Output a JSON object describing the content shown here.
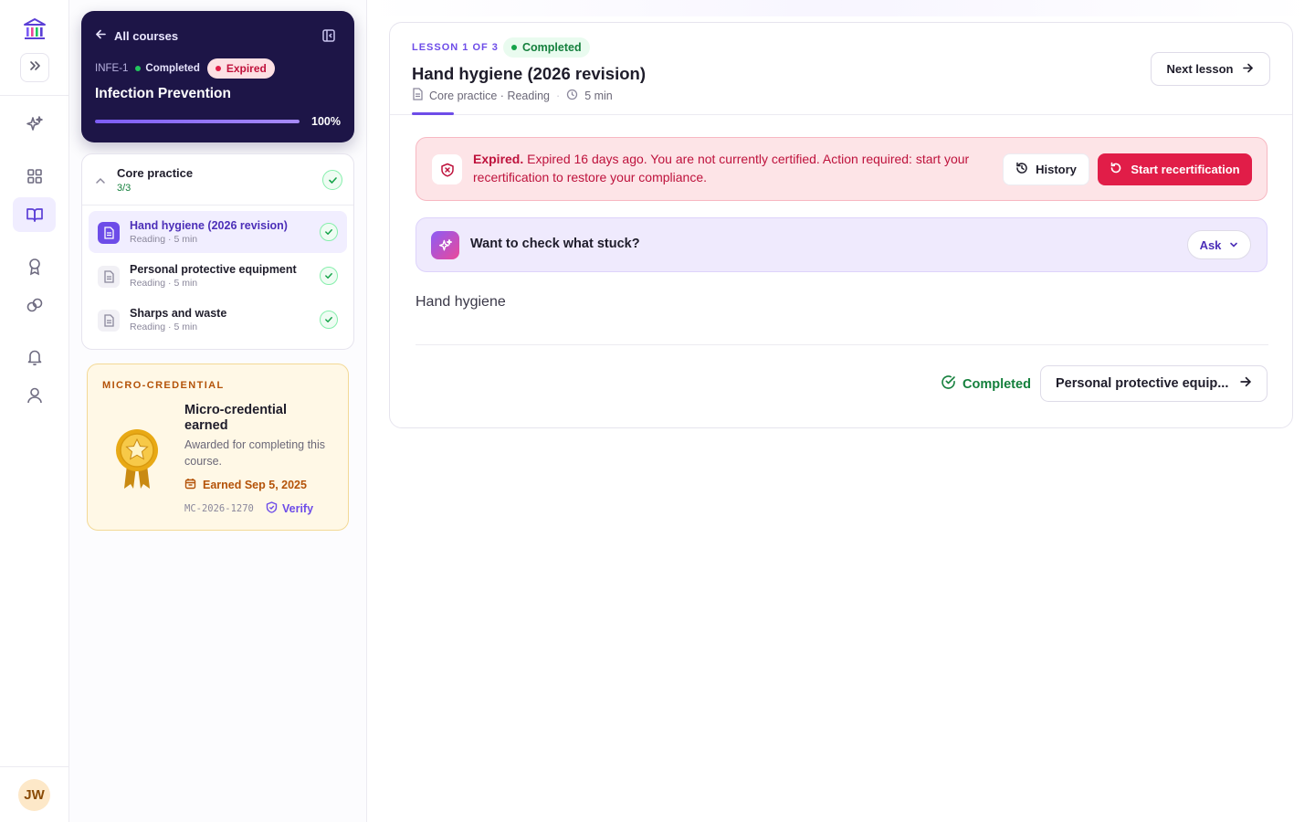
{
  "rail": {
    "avatar_initials": "JW",
    "icons": [
      "institution-logo-icon",
      "expand-icon",
      "sparkle-icon",
      "dashboard-icon",
      "book-icon",
      "award-icon",
      "link-icon",
      "bell-icon",
      "user-icon"
    ]
  },
  "course": {
    "back_label": "All courses",
    "code": "INFE-1",
    "status": "Completed",
    "expired_label": "Expired",
    "title": "Infection Prevention",
    "progress_percent": 100,
    "progress_label": "100%"
  },
  "module": {
    "name": "Core practice",
    "count": "3/3",
    "lessons": [
      {
        "name": "Hand hygiene (2026 revision)",
        "sub": "Reading · 5 min"
      },
      {
        "name": "Personal protective equipment",
        "sub": "Reading · 5 min"
      },
      {
        "name": "Sharps and waste",
        "sub": "Reading · 5 min"
      }
    ]
  },
  "credential": {
    "eyebrow": "MICRO-CREDENTIAL",
    "title": "Micro-credential earned",
    "description": "Awarded for completing this course.",
    "earned": "Earned Sep 5, 2025",
    "id": "MC-2026-1270",
    "verify_label": "Verify"
  },
  "lesson": {
    "eyebrow": "LESSON 1 OF 3",
    "status": "Completed",
    "title": "Hand hygiene (2026 revision)",
    "meta": "Core practice · Reading",
    "duration": "5 min",
    "next_label": "Next lesson",
    "body": "Hand hygiene",
    "completed_label": "Completed",
    "next_card_label": "Personal protective equip..."
  },
  "alert": {
    "strong": "Expired.",
    "text": " Expired 16 days ago. You are not currently certified. Action required: start your recertification to restore your compliance.",
    "history_label": "History",
    "recert_label": "Start recertification"
  },
  "ask": {
    "question": "Want to check what stuck?",
    "button_label": "Ask"
  },
  "colors": {
    "accent": "#6d4ce8",
    "navy": "#1d1547",
    "danger": "#e11d48",
    "success": "#15803d",
    "gold": "#b45309"
  }
}
